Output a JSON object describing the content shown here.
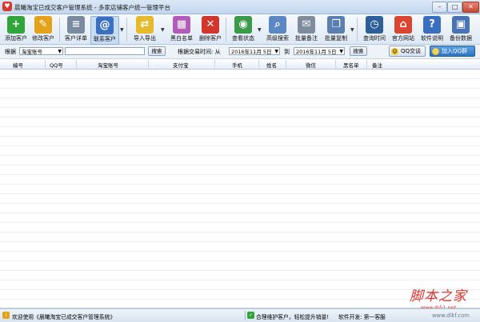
{
  "window": {
    "title": "晨曦淘宝已成交客户管理系统 - 多家店铺客户统一管理平台",
    "controls": {
      "minimize": "–",
      "maximize": "□",
      "close": "✕"
    }
  },
  "toolbar": {
    "items": [
      {
        "label": "添加客户",
        "icon": "add-icon",
        "glyph": "+",
        "color": "#2fa53a"
      },
      {
        "label": "修改客户",
        "icon": "edit-icon",
        "glyph": "✎",
        "color": "#e3a21a"
      },
      {
        "label": "客户详单",
        "icon": "document-icon",
        "glyph": "≡",
        "color": "#7a8aa0"
      },
      {
        "label": "联系客户",
        "icon": "at-icon",
        "glyph": "@",
        "color": "#3b6fc2"
      },
      {
        "label": "导入导出",
        "icon": "folder-icon",
        "glyph": "⇄",
        "color": "#e7b92c"
      },
      {
        "label": "黑白名单",
        "icon": "list-icon",
        "glyph": "▦",
        "color": "#b05cb8"
      },
      {
        "label": "删除客户",
        "icon": "delete-icon",
        "glyph": "✕",
        "color": "#d2352c"
      },
      {
        "label": "查看状态",
        "icon": "status-icon",
        "glyph": "◉",
        "color": "#3a9a4a"
      },
      {
        "label": "高级搜索",
        "icon": "search-icon",
        "glyph": "⌕",
        "color": "#5b87c5"
      },
      {
        "label": "批量备注",
        "icon": "note-icon",
        "glyph": "✉",
        "color": "#7e8c9e"
      },
      {
        "label": "批量复制",
        "icon": "copy-icon",
        "glyph": "❐",
        "color": "#5a7fb0"
      },
      {
        "label": "查询时间",
        "icon": "clock-icon",
        "glyph": "◷",
        "color": "#2f5f9a"
      },
      {
        "label": "官方网站",
        "icon": "home-icon",
        "glyph": "⌂",
        "color": "#d9452f"
      },
      {
        "label": "软件说明",
        "icon": "help-icon",
        "glyph": "?",
        "color": "#3a6ec0"
      },
      {
        "label": "备份数据",
        "icon": "save-icon",
        "glyph": "▣",
        "color": "#4a73b6"
      }
    ]
  },
  "search": {
    "by_label": "根据",
    "field_value": "淘宝账号",
    "search_button": "搜索",
    "time_label": "根据交易时间: 从",
    "date_from": "2016年11月 5日",
    "to_label": "到",
    "date_to": "2016年11月 5日",
    "search_button2": "搜索",
    "qq_chat": "QQ交谈",
    "join_qq": "加入QQ群"
  },
  "table": {
    "columns": [
      "编号",
      "QQ号",
      "淘宝账号",
      "支付宝",
      "手机",
      "姓名",
      "微信",
      "黑名单",
      "备注"
    ],
    "rows": []
  },
  "status": {
    "welcome": "欢迎使用《晨曦淘宝已成交客户管理系统》",
    "tip": "合理维护客户，轻松提升销量!",
    "developer": "软件开发: 第一客服"
  },
  "watermark": {
    "main": "脚本之家",
    "sub": "www.jb51.net"
  },
  "watermark2": "www.dlkf.com"
}
